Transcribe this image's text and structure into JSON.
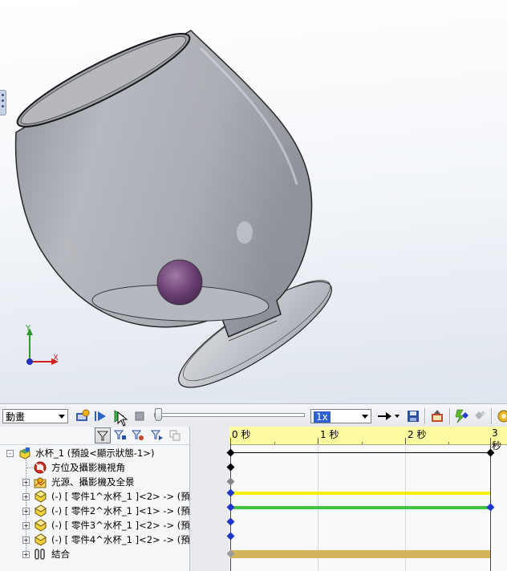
{
  "viewport": {
    "axis_y_label": "Y",
    "axis_x_label": "X"
  },
  "toolbar": {
    "study_type": "動畫",
    "playback_speed": "1x"
  },
  "timeline": {
    "ticks": [
      "0 秒",
      "1 秒",
      "2 秒",
      "3 秒"
    ]
  },
  "tree": {
    "items": [
      {
        "label": "水杯_1  (預設<顯示狀態-1>)",
        "icon": "assembly-icon"
      },
      {
        "label": "方位及攝影機視角",
        "icon": "orientation-camera-icon"
      },
      {
        "label": "光源、攝影機及全景",
        "icon": "lights-cameras-scene-icon"
      },
      {
        "label": "(-) [ 零件1^水杯_1 ]<2> -> (預",
        "icon": "part-icon"
      },
      {
        "label": "(-) [ 零件2^水杯_1 ]<1> -> (預",
        "icon": "part-icon"
      },
      {
        "label": "(-) [ 零件3^水杯_1 ]<2> -> (預",
        "icon": "part-icon"
      },
      {
        "label": "(-) [ 零件4^水杯_1 ]<2> -> (預",
        "icon": "part-icon"
      },
      {
        "label": "結合",
        "icon": "mates-icon"
      }
    ]
  },
  "colors": {
    "ruler_yellow": "#fbfa9e",
    "bar_yellow": "#f4f000",
    "bar_green": "#43c33d",
    "bar_mates": "#d2b45c",
    "key_blue": "#1e35c8"
  }
}
